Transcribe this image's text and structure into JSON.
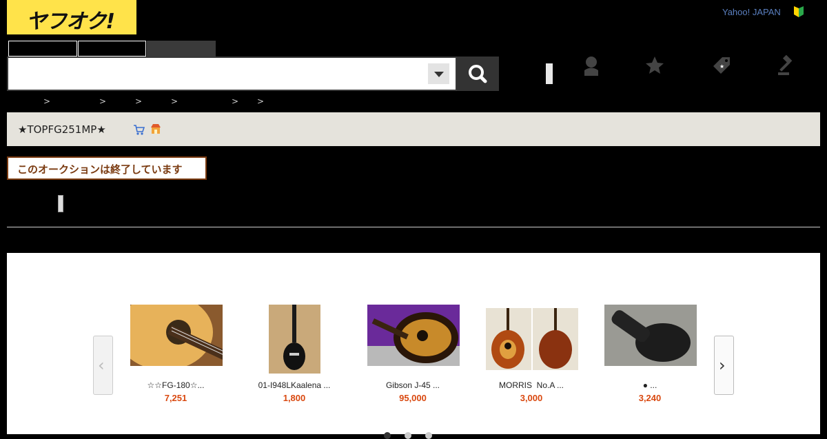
{
  "header": {
    "logo_text": "ヤフオク!",
    "yahoo_link": "Yahoo! JAPAN",
    "beginner_icon": "beginner-mark-icon"
  },
  "search": {
    "value": "",
    "placeholder": ""
  },
  "nav_icons": [
    "user-icon",
    "star-icon",
    "coupon-tag-icon",
    "auction-gavel-icon"
  ],
  "seller": {
    "name": "★TOPFG251MP★",
    "icons": [
      "cart-icon",
      "store-icon"
    ]
  },
  "status": {
    "ended_label": "このオークションは終了しています"
  },
  "carousel": {
    "items": [
      {
        "title": "☆☆FG-180☆...",
        "price": "7,251"
      },
      {
        "title": "01-I948LKaalena ...",
        "price": "1,800"
      },
      {
        "title": "Gibson J-45 ...",
        "price": "95,000"
      },
      {
        "title": "MORRIS  No.A ...",
        "price": "3,000"
      },
      {
        "title": "● ...",
        "price": "3,240"
      }
    ]
  },
  "colors": {
    "logo_yellow": "#ffe34a",
    "price_red": "#d9480f",
    "ended_border": "#7a3a10"
  }
}
